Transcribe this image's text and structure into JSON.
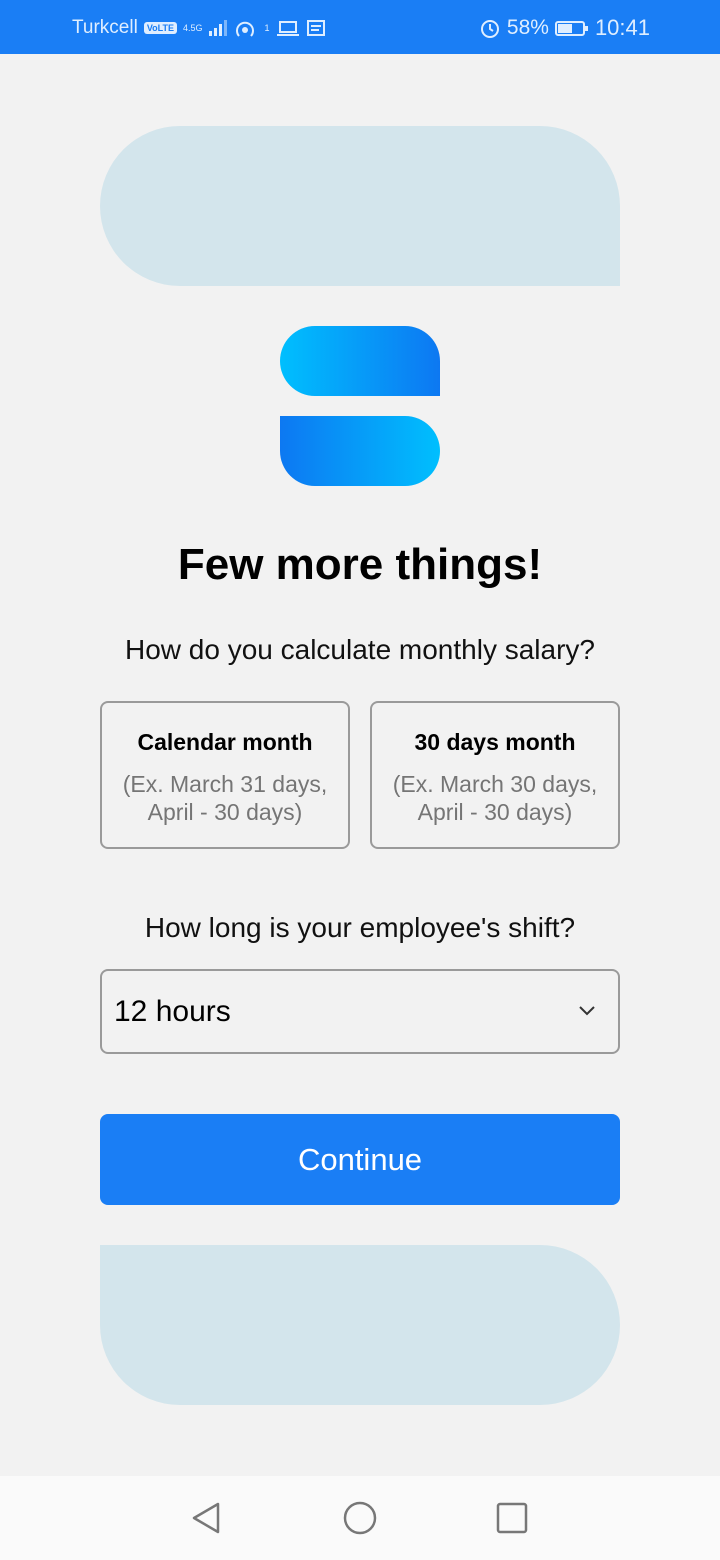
{
  "status_bar": {
    "carrier": "Turkcell",
    "volte": "VoLTE",
    "network": "4.5G",
    "hotspot_count": "1",
    "battery_percent": "58%",
    "battery_level": 0.58,
    "time": "10:41"
  },
  "page": {
    "title": "Few more things!",
    "salary_question": "How do you calculate monthly salary?",
    "options": [
      {
        "title": "Calendar month",
        "description": "(Ex. March 31 days, April - 30 days)"
      },
      {
        "title": "30 days month",
        "description": "(Ex. March 30 days, April - 30 days)"
      }
    ],
    "shift_question": "How long is your employee's shift?",
    "shift_select": {
      "value": "12 hours"
    },
    "continue_label": "Continue"
  },
  "colors": {
    "primary": "#1a7ef5",
    "deco": "#d3e5ec",
    "logo_light": "#00bffe",
    "logo_dark": "#0d78f2",
    "background": "#f2f2f2"
  },
  "icons": {
    "logo": "app-logo",
    "select": "chevron-down-icon",
    "nav": [
      "back-icon",
      "home-icon",
      "recent-apps-icon"
    ]
  }
}
